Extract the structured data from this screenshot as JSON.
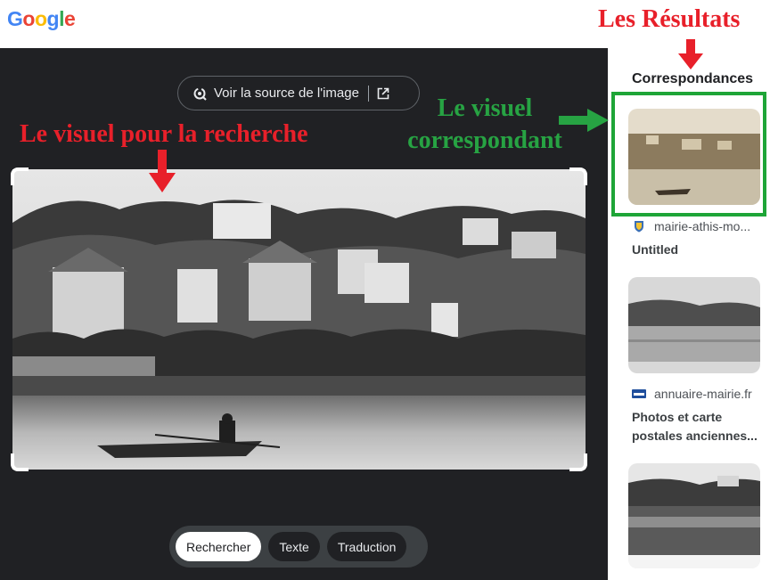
{
  "header": {
    "logo": [
      "G",
      "o",
      "o",
      "g",
      "l",
      "e"
    ],
    "logo_colors": [
      "#4285f4",
      "#ea4335",
      "#fbbc05",
      "#4285f4",
      "#34a853",
      "#ea4335"
    ]
  },
  "viewer": {
    "source_button": "Voir la source de l'image",
    "tabs": [
      {
        "label": "Rechercher",
        "active": true
      },
      {
        "label": "Texte",
        "active": false
      },
      {
        "label": "Traduction",
        "active": false
      }
    ]
  },
  "results": {
    "title": "Correspondances",
    "items": [
      {
        "site": "mairie-athis-mo...",
        "caption": "Untitled"
      },
      {
        "site": "annuaire-mairie.fr",
        "caption_lines": [
          "Photos et carte",
          "postales anciennes..."
        ]
      }
    ]
  },
  "annotations": {
    "results_label": "Les Résultats",
    "search_visual_label": "Le visuel pour la recherche",
    "match_label_line1": "Le visuel",
    "match_label_line2": "correspondant",
    "red_color": "#e8202a",
    "green_color": "#27a343"
  }
}
